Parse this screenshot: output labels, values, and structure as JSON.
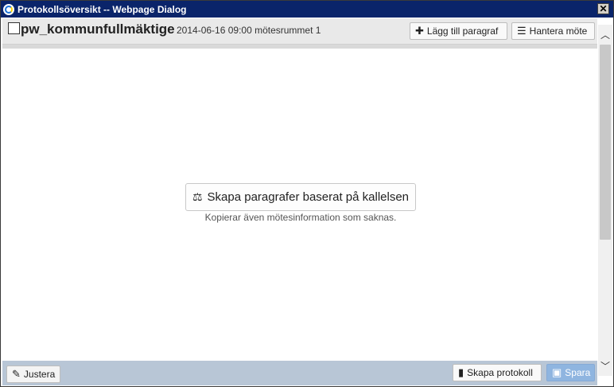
{
  "window": {
    "title": "Protokollsöversikt -- Webpage Dialog",
    "close_label": "✕"
  },
  "header": {
    "meeting_name": "pw_kommunfullmäktige",
    "meeting_info": "2014-06-16 09:00 mötesrummet 1",
    "add_paragraph_label": "Lägg till paragraf",
    "manage_meeting_label": "Hantera möte"
  },
  "main": {
    "create_paragraphs_label": "Skapa paragrafer baserat på kallelsen",
    "create_paragraphs_hint": "Kopierar även mötesinformation som saknas."
  },
  "footer": {
    "adjust_label": "Justera",
    "create_protocol_label": "Skapa protokoll",
    "save_label": "Spara"
  },
  "icons": {
    "window": "ie-icon",
    "add": "plus-icon",
    "manage": "list-icon",
    "create": "stamp-icon",
    "adjust": "pencil-icon",
    "protocol": "file-icon",
    "save": "floppy-disk-icon"
  },
  "colors": {
    "titlebar": "#0a246a",
    "footer": "#b8c6d6",
    "save_button": "#8fb5e0"
  }
}
